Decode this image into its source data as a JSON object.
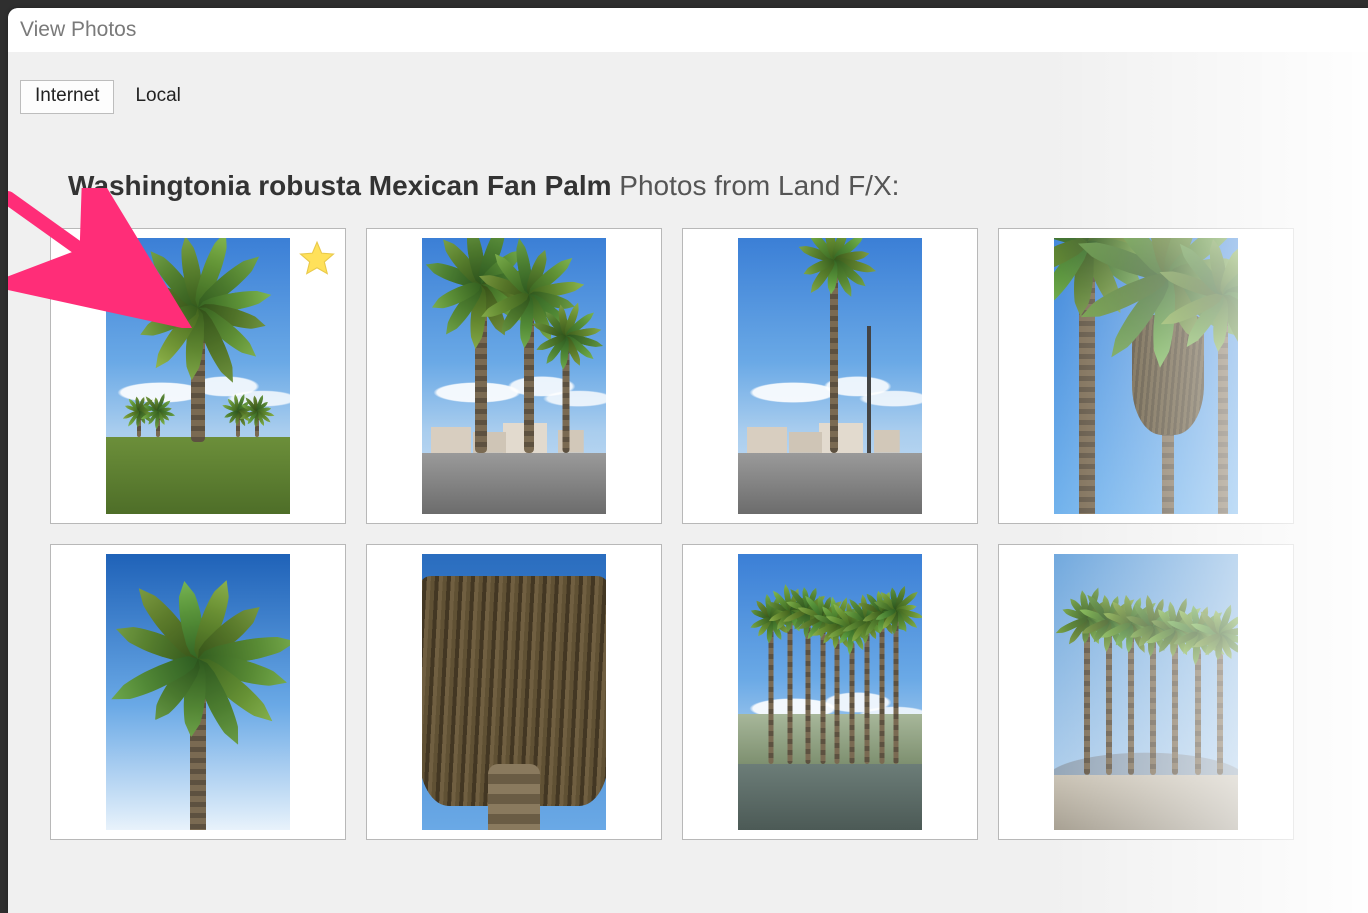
{
  "window": {
    "title": "View Photos"
  },
  "tabs": {
    "internet": "Internet",
    "local": "Local",
    "active": "internet"
  },
  "heading": {
    "bold": "Washingtonia robusta Mexican Fan Palm",
    "rest": " Photos from Land F/X:"
  },
  "annotation": {
    "arrow_color": "#ff2d78",
    "star_color": "#ffe15a"
  },
  "thumbnails": [
    {
      "id": 1,
      "starred": true,
      "scene": "grass-single"
    },
    {
      "id": 2,
      "starred": false,
      "scene": "street-multi"
    },
    {
      "id": 3,
      "starred": false,
      "scene": "tall-street"
    },
    {
      "id": 4,
      "starred": false,
      "scene": "lookup-multi"
    },
    {
      "id": 5,
      "starred": false,
      "scene": "gradient-single"
    },
    {
      "id": 6,
      "starred": false,
      "scene": "skirt-closeup"
    },
    {
      "id": 7,
      "starred": false,
      "scene": "lagoon-row"
    },
    {
      "id": 8,
      "starred": false,
      "scene": "desert-row"
    }
  ]
}
